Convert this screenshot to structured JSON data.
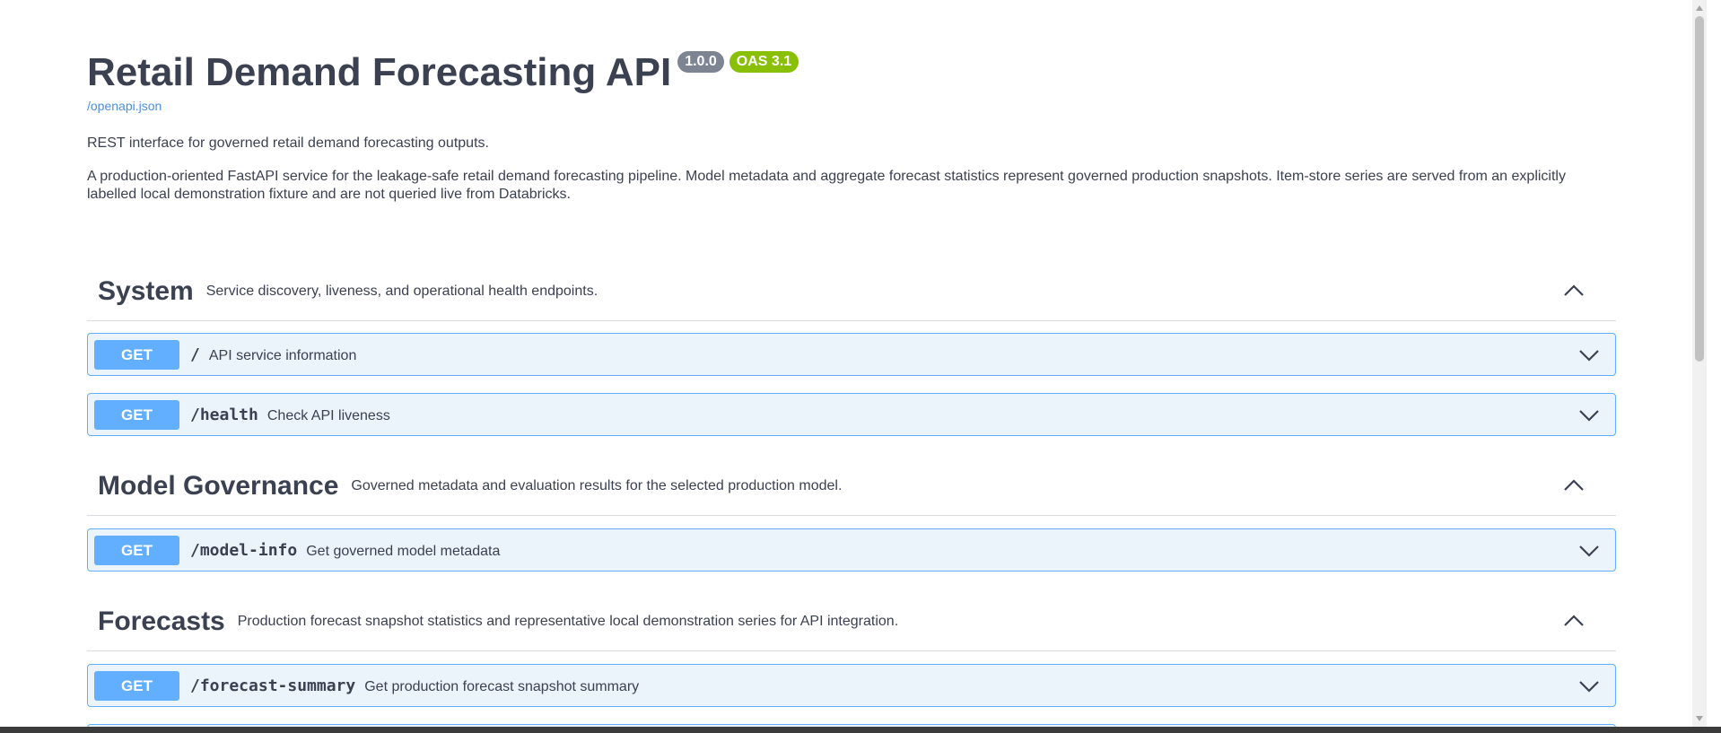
{
  "header": {
    "title": "Retail Demand Forecasting API",
    "version_badge": "1.0.0",
    "oas_badge": "OAS 3.1",
    "spec_link": "/openapi.json",
    "description_short": "REST interface for governed retail demand forecasting outputs.",
    "description_long": "A production-oriented FastAPI service for the leakage-safe retail demand forecasting pipeline. Model metadata and aggregate forecast statistics represent governed production snapshots. Item-store series are served from an explicitly labelled local demonstration fixture and are not queried live from Databricks."
  },
  "sections": [
    {
      "name": "System",
      "description": "Service discovery, liveness, and operational health endpoints.",
      "operations": [
        {
          "method": "GET",
          "path": "/",
          "summary": "API service information"
        },
        {
          "method": "GET",
          "path": "/health",
          "summary": "Check API liveness"
        }
      ]
    },
    {
      "name": "Model Governance",
      "description": "Governed metadata and evaluation results for the selected production model.",
      "operations": [
        {
          "method": "GET",
          "path": "/model-info",
          "summary": "Get governed model metadata"
        }
      ]
    },
    {
      "name": "Forecasts",
      "description": "Production forecast snapshot statistics and representative local demonstration series for API integration.",
      "operations": [
        {
          "method": "GET",
          "path": "/forecast-summary",
          "summary": "Get production forecast snapshot summary"
        }
      ]
    }
  ],
  "colors": {
    "get_accent": "#61affe",
    "get_background": "#ebf3fb",
    "version_badge": "#7d8492",
    "oas_badge": "#89bf04",
    "link": "#4990e2"
  },
  "icons": {
    "section_toggle": "chevron-up-icon",
    "operation_toggle": "chevron-down-icon"
  }
}
